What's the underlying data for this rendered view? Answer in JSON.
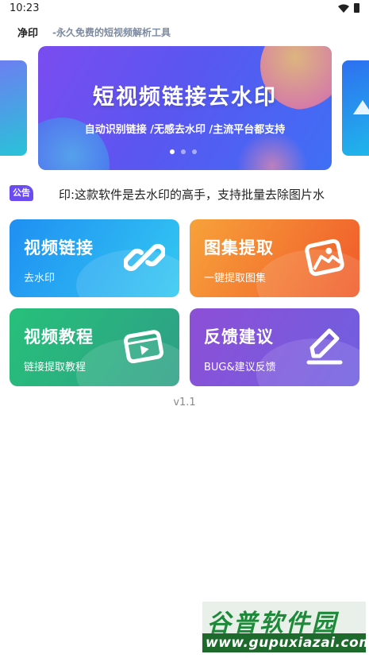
{
  "status_bar": {
    "time": "10:23",
    "icons": [
      "wifi-icon",
      "battery-icon"
    ]
  },
  "header": {
    "app_name": "净印",
    "slogan": "-永久免费的短视频解析工具"
  },
  "banner": {
    "title": "短视频链接去水印",
    "subtitle": "自动识别链接 /无感去水印 /主流平台都支持",
    "slide_count": 3,
    "active_slide": 1
  },
  "notice": {
    "badge": "公告",
    "text": "印:这款软件是去水印的高手，支持批量去除图片水"
  },
  "cards": [
    {
      "title": "视频链接",
      "subtitle": "去水印",
      "icon": "link-icon",
      "color_start": "#1f8ff2",
      "color_end": "#33c8f2"
    },
    {
      "title": "图集提取",
      "subtitle": "一键提取图集",
      "icon": "image-icon",
      "color_start": "#f7a23a",
      "color_end": "#f05a2a"
    },
    {
      "title": "视频教程",
      "subtitle": "链接提取教程",
      "icon": "video-play-icon",
      "color_start": "#27c07a",
      "color_end": "#2e9f86"
    },
    {
      "title": "反馈建议",
      "subtitle": "BUG&建议反馈",
      "icon": "pencil-icon",
      "color_start": "#8d4fd6",
      "color_end": "#6f5fe0"
    }
  ],
  "version": "v1.1",
  "watermark": {
    "brand": "谷普软件园",
    "url": "www.gupuxiazai.com"
  },
  "colors": {
    "accent": "#6a4cf0",
    "slogan": "#7b8aa0"
  }
}
